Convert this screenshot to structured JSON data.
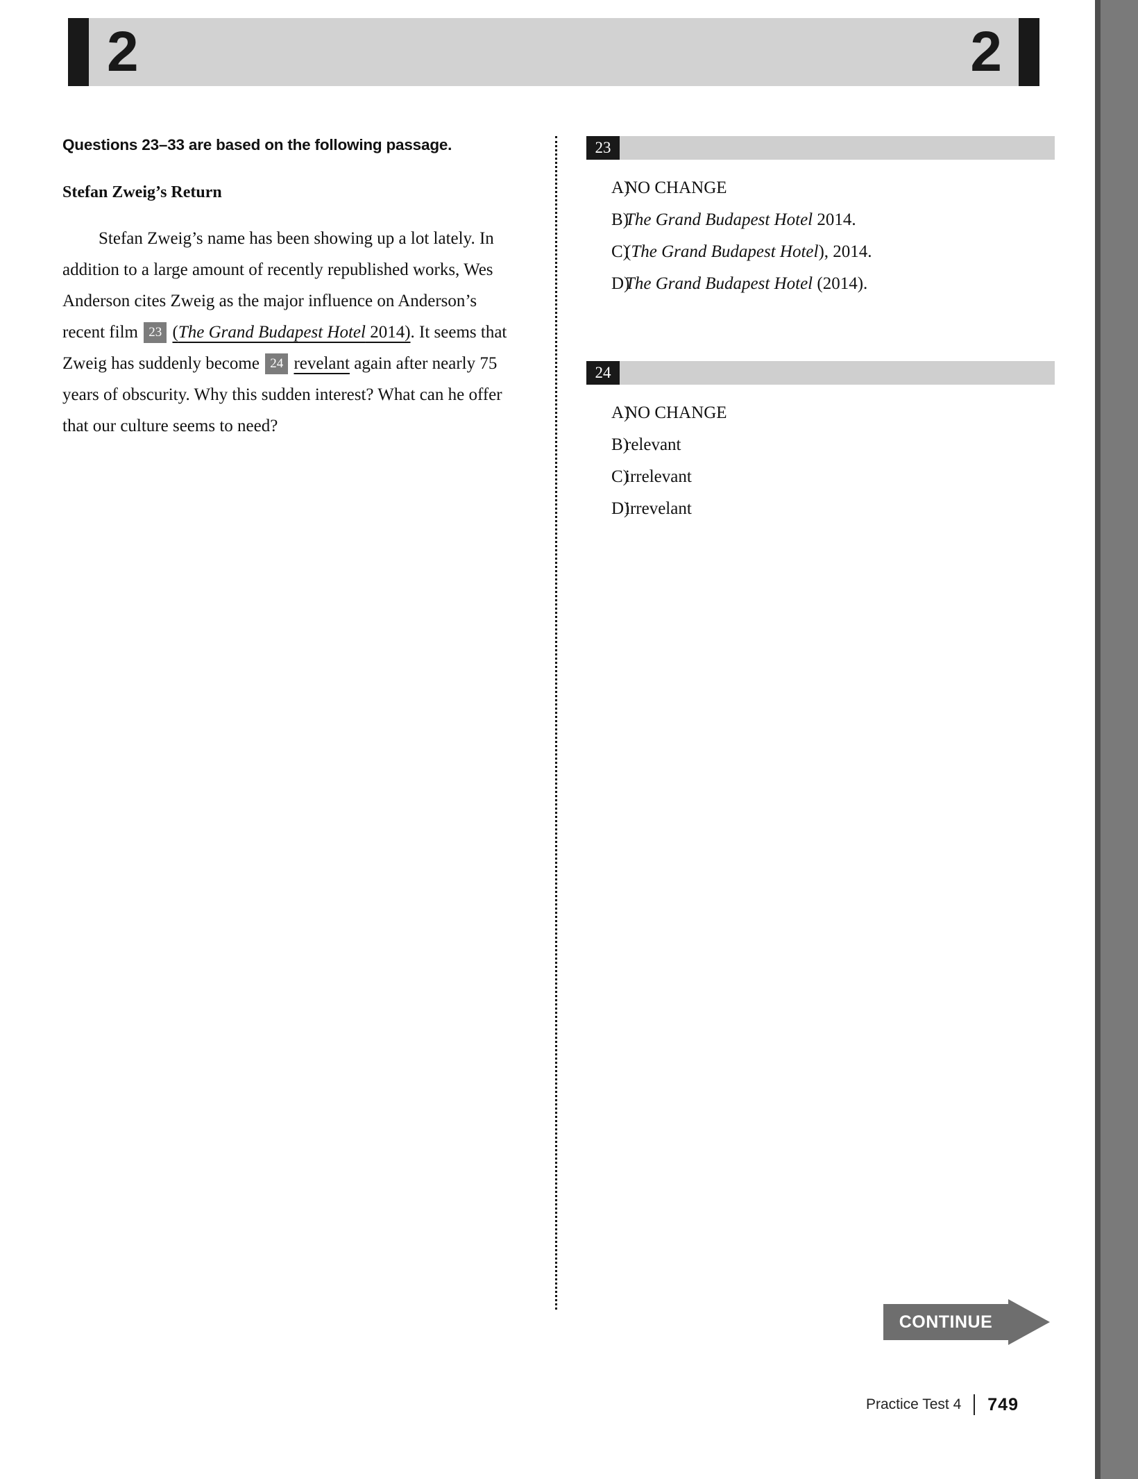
{
  "header": {
    "section_number_left": "2",
    "section_number_right": "2"
  },
  "passage": {
    "questions_line": "Questions 23–33 are based on the following passage.",
    "title": "Stefan Zweig’s Return",
    "text_part_1": "Stefan Zweig’s name has been showing up a lot lately. In addition to a large amount of recently republished works, Wes Anderson cites Zweig as the major influence on Anderson’s recent film ",
    "marker_23": "23",
    "underlined_23_open_paren": "(",
    "underlined_23_italic": "The Grand Budapest Hotel",
    "underlined_23_tail": " 2014)",
    "text_part_2": ". It seems that Zweig has suddenly become ",
    "marker_24": "24",
    "underlined_24": "revelant",
    "text_part_3": " again after nearly 75 years of obscurity. Why this sudden interest? What can he offer that our culture seems to need?"
  },
  "questions": [
    {
      "number": "23",
      "choices": [
        {
          "label": "A)",
          "text": "NO CHANGE",
          "italic_part": "",
          "plain_tail": "",
          "style": "plain"
        },
        {
          "label": "B)",
          "text": "The Grand Budapest Hotel 2014.",
          "italic_part": "The Grand Budapest Hotel",
          "plain_tail": " 2014.",
          "style": "italic-lead"
        },
        {
          "label": "C)",
          "text": "(The Grand Budapest Hotel), 2014.",
          "italic_part": "The Grand Budapest Hotel",
          "plain_tail": "), 2014.",
          "plain_head": "(",
          "style": "paren-italic"
        },
        {
          "label": "D)",
          "text": "The Grand Budapest Hotel (2014).",
          "italic_part": "The Grand Budapest Hotel",
          "plain_tail": " (2014).",
          "style": "italic-lead"
        }
      ]
    },
    {
      "number": "24",
      "choices": [
        {
          "label": "A)",
          "text": "NO CHANGE",
          "italic_part": "",
          "plain_tail": "",
          "style": "plain"
        },
        {
          "label": "B)",
          "text": "relevant",
          "italic_part": "",
          "plain_tail": "",
          "style": "plain"
        },
        {
          "label": "C)",
          "text": "irrelevant",
          "italic_part": "",
          "plain_tail": "",
          "style": "plain"
        },
        {
          "label": "D)",
          "text": "irrevelant",
          "italic_part": "",
          "plain_tail": "",
          "style": "plain"
        }
      ]
    }
  ],
  "continue_banner": {
    "label": "CONTINUE"
  },
  "footer": {
    "test_name": "Practice Test 4",
    "page_number": "749"
  },
  "colors": {
    "header_bar": "#d2d2d2",
    "header_tab": "#191919",
    "question_bar": "#cfcfcf",
    "question_num_box": "#191919",
    "inline_marker": "#7c7c7c",
    "continue": "#6e6e6e",
    "gutter": "#7a7a7a"
  }
}
